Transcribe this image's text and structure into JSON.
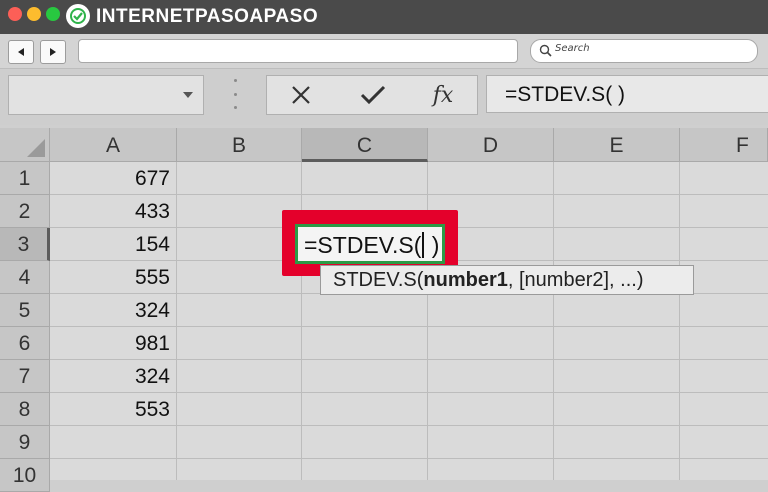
{
  "browser": {
    "logo_text": "INTERNETPASOAPASO",
    "search_placeholder": "Search",
    "back_icon": "back-arrow-icon",
    "forward_icon": "forward-arrow-icon"
  },
  "formula_bar": {
    "name_box": "",
    "cancel_icon": "close-icon",
    "enter_icon": "check-icon",
    "fx_label": "fx",
    "formula": "=STDEV.S( )"
  },
  "sheet": {
    "columns": [
      "A",
      "B",
      "C",
      "D",
      "E",
      "F"
    ],
    "active_column": "C",
    "rows": [
      "1",
      "2",
      "3",
      "4",
      "5",
      "6",
      "7",
      "8",
      "9",
      "10"
    ],
    "active_row": "3",
    "column_a_values": [
      "677",
      "433",
      "154",
      "555",
      "324",
      "981",
      "324",
      "553"
    ],
    "editing_cell": {
      "ref": "C3",
      "text_before_caret": "=STDEV.S(",
      "text_after_caret": " )"
    },
    "tooltip": {
      "func": "STDEV.S(",
      "arg_bold": "number1",
      "rest": ", [number2], ...)"
    }
  },
  "colors": {
    "highlight": "#e4002b",
    "edit_border": "#2c9a46"
  }
}
